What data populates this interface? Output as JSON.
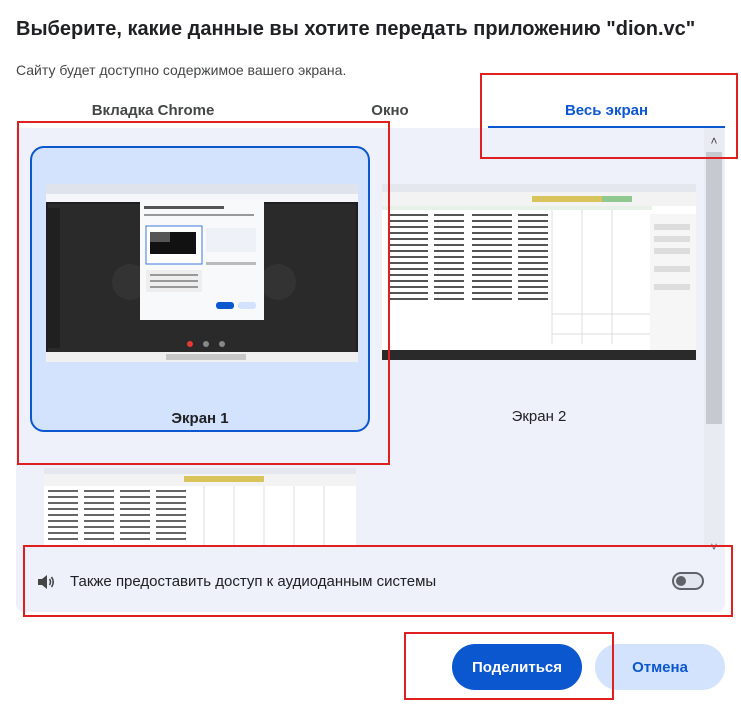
{
  "dialog": {
    "title": "Выберите, какие данные вы хотите передать приложению \"dion.vc\"",
    "subtitle": "Сайту будет доступно содержимое вашего экрана."
  },
  "tabs": [
    {
      "label": "Вкладка Chrome",
      "selected": false
    },
    {
      "label": "Окно",
      "selected": false
    },
    {
      "label": "Весь экран",
      "selected": true
    }
  ],
  "screens": [
    {
      "label": "Экран 1",
      "selected": true
    },
    {
      "label": "Экран 2",
      "selected": false
    }
  ],
  "audio": {
    "label": "Также предоставить доступ к аудиоданным системы",
    "enabled": false
  },
  "buttons": {
    "share": "Поделиться",
    "cancel": "Отмена"
  },
  "scrollbar": {
    "up": "˄",
    "down": "˅"
  },
  "colors": {
    "accent": "#0b57d0",
    "selected_card": "#d3e3fd",
    "panel": "#eef1fa",
    "annotation": "#e02020"
  }
}
